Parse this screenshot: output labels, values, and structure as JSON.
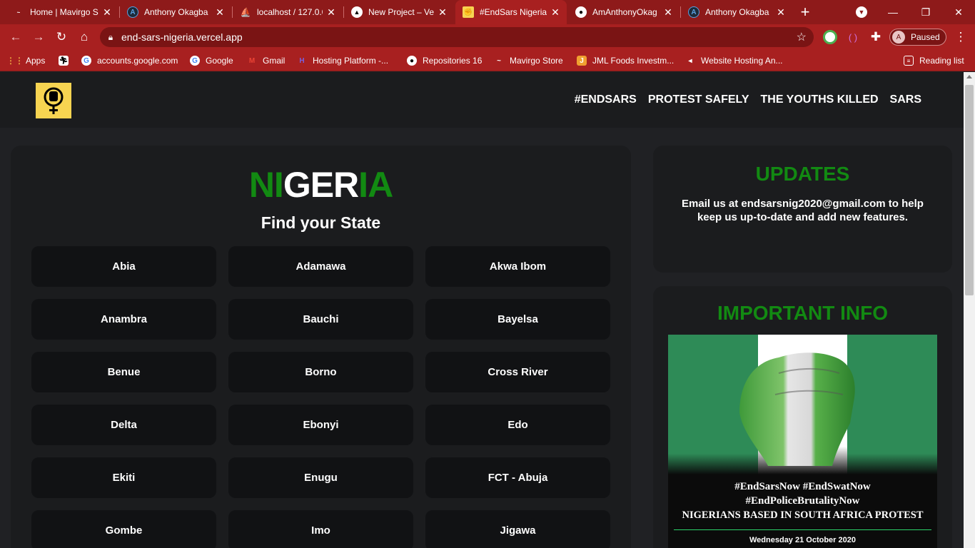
{
  "browser": {
    "tabs": [
      {
        "title": "Home | Mavirgo S",
        "icon": "mavirgo-logo",
        "icon_color": "#ffffff",
        "active": false
      },
      {
        "title": "Anthony Okagba",
        "icon": "circle-a",
        "icon_color": "#5aa0e0",
        "active": false
      },
      {
        "title": "localhost / 127.0.0",
        "icon": "phpmyadmin-logo",
        "icon_color": "#f0a030",
        "active": false
      },
      {
        "title": "New Project – Ver",
        "icon": "vercel-triangle",
        "icon_color": "#000000",
        "active": false
      },
      {
        "title": "#EndSars Nigeria",
        "icon": "fist-logo",
        "icon_color": "#f7d451",
        "active": true
      },
      {
        "title": "AmAnthonyOkag",
        "icon": "github-logo",
        "icon_color": "#ffffff",
        "active": false
      },
      {
        "title": "Anthony Okagba",
        "icon": "circle-a",
        "icon_color": "#5aa0e0",
        "active": false
      }
    ],
    "url": "end-sars-nigeria.vercel.app",
    "profile_status": "Paused",
    "profile_initial": "A",
    "bookmarks": [
      {
        "label": "Apps",
        "icon": "apps-grid-icon"
      },
      {
        "label": "",
        "icon": "runner-icon"
      },
      {
        "label": "accounts.google.com",
        "icon": "google-icon"
      },
      {
        "label": "Google",
        "icon": "google-icon"
      },
      {
        "label": "Gmail",
        "icon": "gmail-icon"
      },
      {
        "label": "Hosting Platform -...",
        "icon": "hosting-icon"
      },
      {
        "label": "Repositories 16",
        "icon": "github-icon"
      },
      {
        "label": "Mavirgo Store",
        "icon": "mavirgo-icon"
      },
      {
        "label": "JML Foods Investm...",
        "icon": "jml-icon"
      },
      {
        "label": "Website Hosting An...",
        "icon": "hosting-arrow-icon"
      }
    ],
    "reading_list": "Reading list"
  },
  "site": {
    "nav": [
      "#ENDSARS",
      "PROTEST SAFELY",
      "THE YOUTHS KILLED",
      "SARS"
    ],
    "heading_parts": [
      {
        "text": "NI",
        "color": "green"
      },
      {
        "text": "GER",
        "color": "white"
      },
      {
        "text": "IA",
        "color": "green"
      }
    ],
    "subheading": "Find your State",
    "states": [
      "Abia",
      "Adamawa",
      "Akwa Ibom",
      "Anambra",
      "Bauchi",
      "Bayelsa",
      "Benue",
      "Borno",
      "Cross River",
      "Delta",
      "Ebonyi",
      "Edo",
      "Ekiti",
      "Enugu",
      "FCT - Abuja",
      "Gombe",
      "Imo",
      "Jigawa"
    ],
    "updates": {
      "title": "UPDATES",
      "text_before": "Email us at ",
      "email": "endsarsnig2020@gmail.com",
      "text_after": " to help keep us up-to-date and add new features."
    },
    "info": {
      "title": "IMPORTANT INFO",
      "poster_lines": [
        "#EndSarsNow #EndSwatNow",
        "#EndPoliceBrutalityNow",
        "NIGERIANS BASED IN SOUTH AFRICA PROTEST",
        "Wednesday 21 October 2020"
      ]
    }
  },
  "colors": {
    "green": "#128a12",
    "accent_yellow": "#f7d451",
    "chrome_red": "#a82020"
  }
}
